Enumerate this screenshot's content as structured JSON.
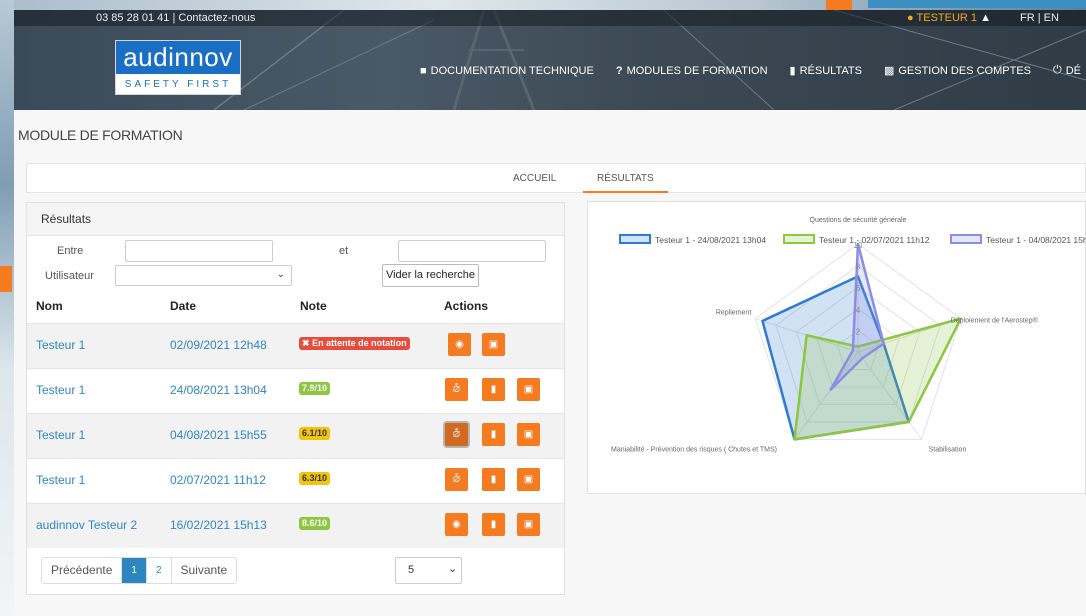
{
  "topbar": {
    "phone": "03 85 28 01 41 | Contactez-nous",
    "user": "TESTEUR 1",
    "languages": "FR | EN"
  },
  "logo": {
    "name": "audinnov",
    "tagline": "SAFETY FIRST"
  },
  "nav": [
    {
      "label": "DOCUMENTATION TECHNIQUE",
      "icon": "book-icon"
    },
    {
      "label": "MODULES DE FORMATION",
      "icon": "question-icon"
    },
    {
      "label": "RÉSULTATS",
      "icon": "clipboard-icon"
    },
    {
      "label": "GESTION DES COMPTES",
      "icon": "id-card-icon"
    },
    {
      "label": "DÉ",
      "icon": "power-icon"
    }
  ],
  "page": {
    "title": "MODULE DE FORMATION"
  },
  "tabs": {
    "home": "ACCUEIL",
    "results": "RÉSULTATS"
  },
  "results": {
    "title": "Résultats",
    "filters": {
      "from_label": "Entre",
      "and_label": "et",
      "user_label": "Utilisateur",
      "clear_label": "Vider la recherche"
    },
    "columns": {
      "name": "Nom",
      "date": "Date",
      "grade": "Note",
      "actions": "Actions"
    },
    "rows": [
      {
        "name": "Testeur 1",
        "date": "02/09/2021 12h48",
        "grade": "En attente de notation",
        "status": "pending"
      },
      {
        "name": "Testeur 1",
        "date": "24/08/2021 13h04",
        "grade": "7.9/10",
        "status": "good"
      },
      {
        "name": "Testeur 1",
        "date": "04/08/2021 15h55",
        "grade": "6.1/10",
        "status": "medium"
      },
      {
        "name": "Testeur 1",
        "date": "02/07/2021 11h12",
        "grade": "6.3/10",
        "status": "medium"
      },
      {
        "name": "audinnov Testeur 2",
        "date": "16/02/2021 15h13",
        "grade": "8.6/10",
        "status": "good"
      }
    ],
    "pagination": {
      "prev": "Précédente",
      "pages": [
        "1",
        "2"
      ],
      "current": "1",
      "next": "Suivante",
      "per_page": "5"
    }
  },
  "colors": {
    "accent": "#f47b20",
    "link": "#2e86c1",
    "pending": "#e74c3c",
    "good": "#8dc63f",
    "medium": "#f1c40f"
  },
  "chart_data": {
    "type": "radar",
    "axes": [
      "Questions de sécurité générale",
      "Déploiement de l'Aerostep®",
      "Stabilisation",
      "Maniabilité - Prévention des risques ( Chutes et TMS)",
      "Repliement"
    ],
    "ticks": [
      "2",
      "4",
      "6",
      "8",
      "10"
    ],
    "rlim": [
      0,
      10
    ],
    "series": [
      {
        "name": "Testeur 1 - 24/08/2021 13h04",
        "color": "#2e7bd0",
        "values": [
          7,
          2.5,
          8,
          10,
          9.3
        ]
      },
      {
        "name": "Testeur 1 - 02/07/2021 11h12",
        "color": "#8dc63f",
        "values": [
          0.5,
          10,
          8,
          10,
          5
        ]
      },
      {
        "name": "Testeur 1 - 04/08/2021 15h",
        "color": "#8c8ce6",
        "values": [
          10,
          2.5,
          0.7,
          4.3,
          0.5
        ]
      }
    ]
  }
}
